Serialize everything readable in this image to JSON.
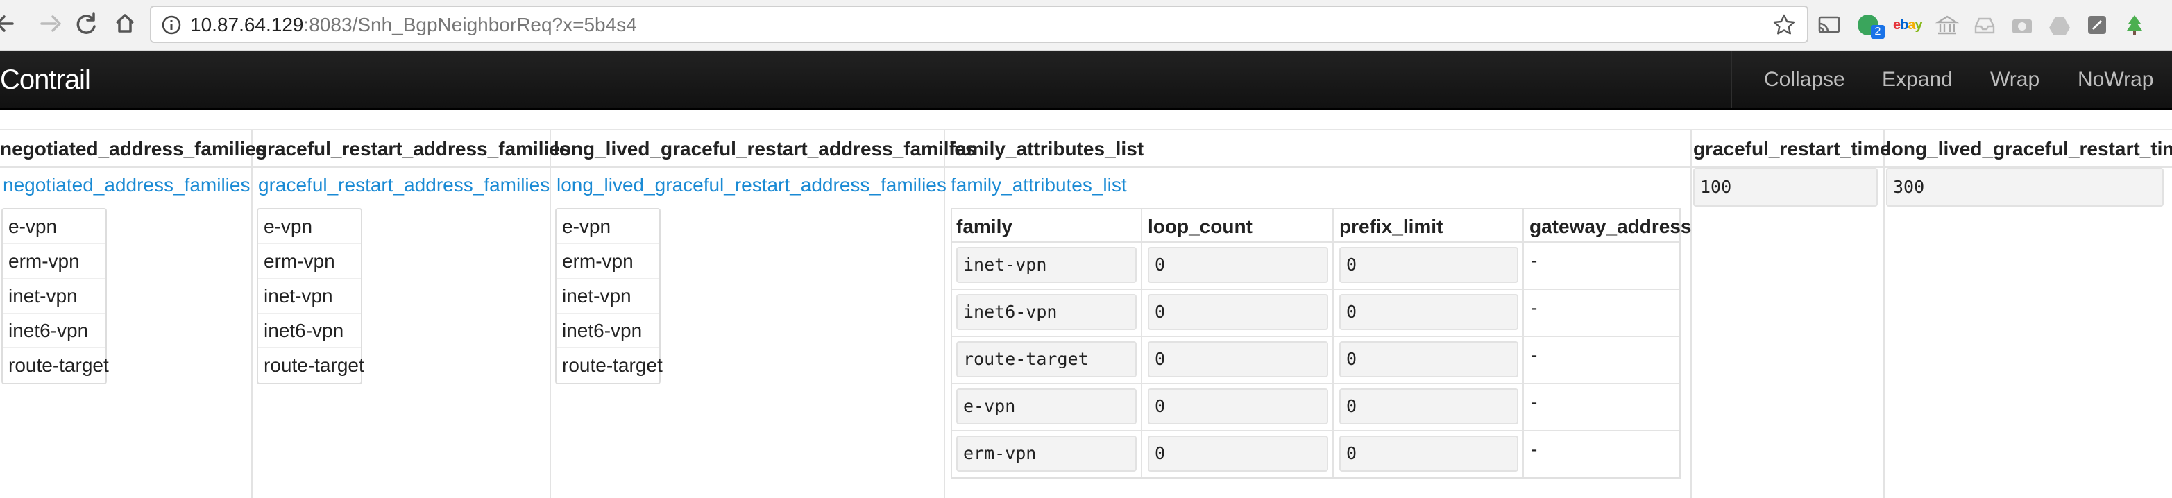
{
  "browser": {
    "url_host": "10.87.64.129",
    "url_rest": ":8083/Snh_BgpNeighborReq?x=5b4s4",
    "extension_badge": "2",
    "ebay_label": "ebay"
  },
  "app": {
    "brand": "Contrail",
    "nav": [
      "Collapse",
      "Expand",
      "Wrap",
      "NoWrap"
    ]
  },
  "table": {
    "columns": {
      "negotiated_address_families": "negotiated_address_families",
      "graceful_restart_address_families": "graceful_restart_address_families",
      "long_lived_graceful_restart_address_families": "long_lived_graceful_restart_address_families",
      "family_attributes_list": "family_attributes_list",
      "graceful_restart_time": "graceful_restart_time",
      "long_lived_graceful_restart_time": "long_lived_graceful_restart_time"
    },
    "links": {
      "negotiated_address_families": "negotiated_address_families",
      "graceful_restart_address_families": "graceful_restart_address_families",
      "long_lived_graceful_restart_address_families": "long_lived_graceful_restart_address_families",
      "family_attributes_list": "family_attributes_list"
    },
    "negotiated_address_families": [
      "e-vpn",
      "erm-vpn",
      "inet-vpn",
      "inet6-vpn",
      "route-target"
    ],
    "graceful_restart_address_families": [
      "e-vpn",
      "erm-vpn",
      "inet-vpn",
      "inet6-vpn",
      "route-target"
    ],
    "long_lived_graceful_restart_address_families": [
      "e-vpn",
      "erm-vpn",
      "inet-vpn",
      "inet6-vpn",
      "route-target"
    ],
    "family_attributes_list": {
      "headers": [
        "family",
        "loop_count",
        "prefix_limit",
        "gateway_address"
      ],
      "rows": [
        {
          "family": "inet-vpn",
          "loop_count": "0",
          "prefix_limit": "0",
          "gateway_address": "-"
        },
        {
          "family": "inet6-vpn",
          "loop_count": "0",
          "prefix_limit": "0",
          "gateway_address": "-"
        },
        {
          "family": "route-target",
          "loop_count": "0",
          "prefix_limit": "0",
          "gateway_address": "-"
        },
        {
          "family": "e-vpn",
          "loop_count": "0",
          "prefix_limit": "0",
          "gateway_address": "-"
        },
        {
          "family": "erm-vpn",
          "loop_count": "0",
          "prefix_limit": "0",
          "gateway_address": "-"
        }
      ]
    },
    "graceful_restart_time": "100",
    "long_lived_graceful_restart_time": "300"
  }
}
